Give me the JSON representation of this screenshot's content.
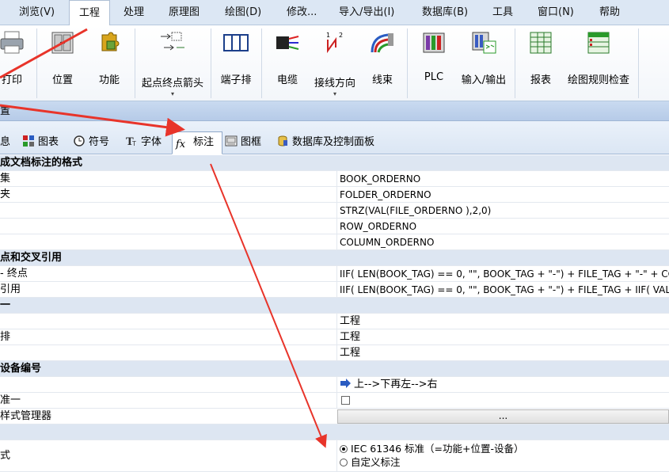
{
  "menu": [
    "浏览(V)",
    "工程",
    "处理",
    "原理图",
    "绘图(D)",
    "修改...",
    "导入/导出(I)",
    "数据库(B)",
    "工具",
    "窗口(N)",
    "帮助"
  ],
  "ribbon": {
    "buttons": [
      {
        "label": "打印",
        "icon": "printer-icon"
      },
      {
        "label": "位置",
        "icon": "location-cabinet-icon"
      },
      {
        "label": "功能",
        "icon": "function-puzzle-icon"
      },
      {
        "label": "起点终点箭头",
        "icon": "start-end-arrow-icon",
        "dropdown": "▾"
      },
      {
        "label": "端子排",
        "icon": "terminal-strip-icon"
      },
      {
        "label": "电缆",
        "icon": "cable-icon"
      },
      {
        "label": "接线方向",
        "icon": "wiring-direction-icon",
        "dropdown": "▾"
      },
      {
        "label": "线束",
        "icon": "harness-icon"
      },
      {
        "label": "PLC",
        "icon": "plc-icon"
      },
      {
        "label": "输入/输出",
        "icon": "io-module-icon"
      },
      {
        "label": "报表",
        "icon": "report-table-icon"
      },
      {
        "label": "绘图规则检查",
        "icon": "drawing-check-icon"
      }
    ]
  },
  "panel_title": "置",
  "tabs": [
    {
      "label": "息"
    },
    {
      "label": "图表"
    },
    {
      "label": "符号"
    },
    {
      "label": "字体"
    },
    {
      "label": "标注"
    },
    {
      "label": "图框"
    },
    {
      "label": "数据库及控制面板"
    }
  ],
  "grid": {
    "section1": "成文档标注的格式",
    "rows1": [
      {
        "name": "集",
        "value": "BOOK_ORDERNO"
      },
      {
        "name": "夹",
        "value": "FOLDER_ORDERNO"
      },
      {
        "name": "",
        "value": "STRZ(VAL(FILE_ORDERNO ),2,0)"
      },
      {
        "name": "",
        "value": "ROW_ORDERNO"
      },
      {
        "name": "",
        "value": "COLUMN_ORDERNO"
      }
    ],
    "section2": "点和交叉引用",
    "rows2": [
      {
        "name": "- 终点",
        "value": "IIF( LEN(BOOK_TAG) == 0, \"\", BOOK_TAG + \"-\") + FILE_TAG + \"-\" + CO"
      },
      {
        "name": "引用",
        "value": "IIF( LEN(BOOK_TAG) == 0, \"\", BOOK_TAG + \"-\") + FILE_TAG + IIF( VAL("
      }
    ],
    "section3": "一",
    "rows3": [
      {
        "name": "",
        "value": "工程"
      },
      {
        "name": "排",
        "value": "工程"
      },
      {
        "name": "",
        "value": "工程"
      }
    ],
    "section4": "设备编号",
    "rows4": [
      {
        "name": "",
        "value": "上-->下再左-->右"
      },
      {
        "name": "准一",
        "value": ""
      },
      {
        "name": "样式管理器",
        "value": "..."
      }
    ],
    "section5": "",
    "rows5": [
      {
        "name": "式",
        "options": [
          "IEC 61346 标准（=功能+位置-设备）",
          "自定义标注"
        ],
        "selected": 0
      }
    ]
  }
}
